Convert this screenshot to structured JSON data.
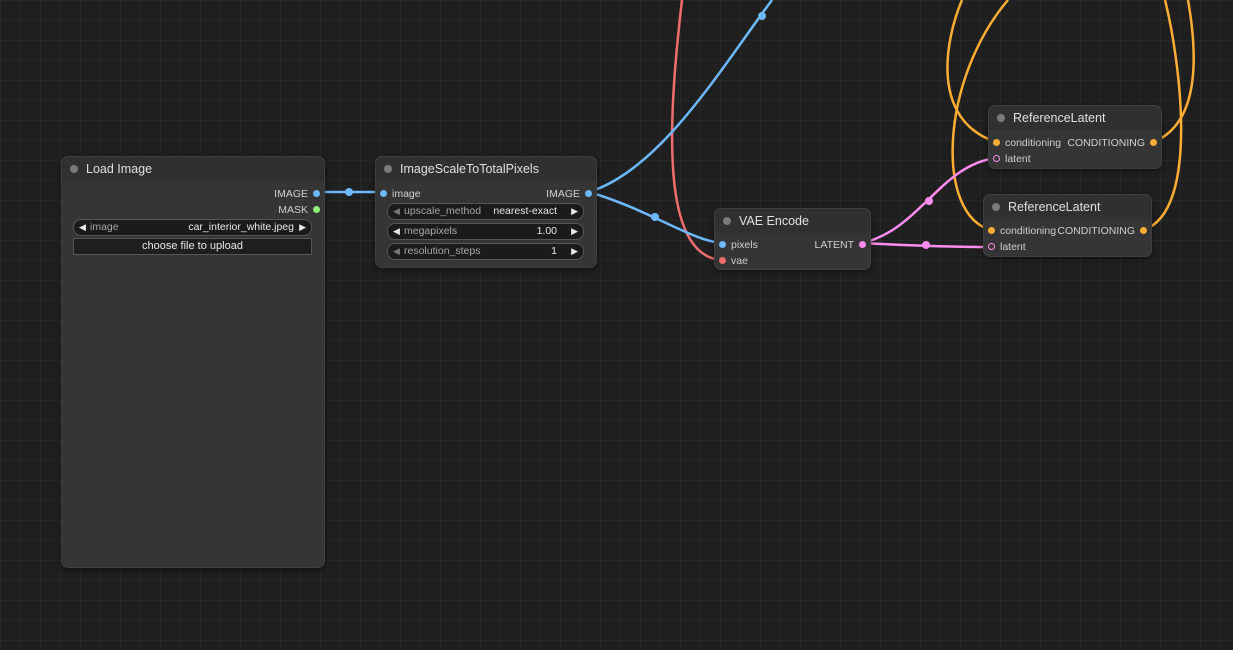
{
  "nodes": {
    "load_image": {
      "title": "Load Image",
      "outputs": [
        "IMAGE",
        "MASK"
      ],
      "image_widget": {
        "label": "image",
        "value": "car_interior_white.jpeg"
      },
      "upload_button": "choose file to upload"
    },
    "image_scale": {
      "title": "ImageScaleToTotalPixels",
      "input": "image",
      "output": "IMAGE",
      "widgets": [
        {
          "label": "upscale_method",
          "value": "nearest-exact"
        },
        {
          "label": "megapixels",
          "value": "1.00"
        },
        {
          "label": "resolution_steps",
          "value": "1"
        }
      ]
    },
    "vae_encode": {
      "title": "VAE Encode",
      "inputs": [
        "pixels",
        "vae"
      ],
      "output": "LATENT"
    },
    "reference_latent_1": {
      "title": "ReferenceLatent",
      "inputs": [
        "conditioning",
        "latent"
      ],
      "output": "CONDITIONING"
    },
    "reference_latent_2": {
      "title": "ReferenceLatent",
      "inputs": [
        "conditioning",
        "latent"
      ],
      "output": "CONDITIONING"
    }
  },
  "colors": {
    "image_link": "#6eb8ff",
    "vae_link": "#ef6d6d",
    "latent_link": "#ff8df0",
    "conditioning_link": "#ffad33",
    "mask_slot": "#8ef27a"
  }
}
